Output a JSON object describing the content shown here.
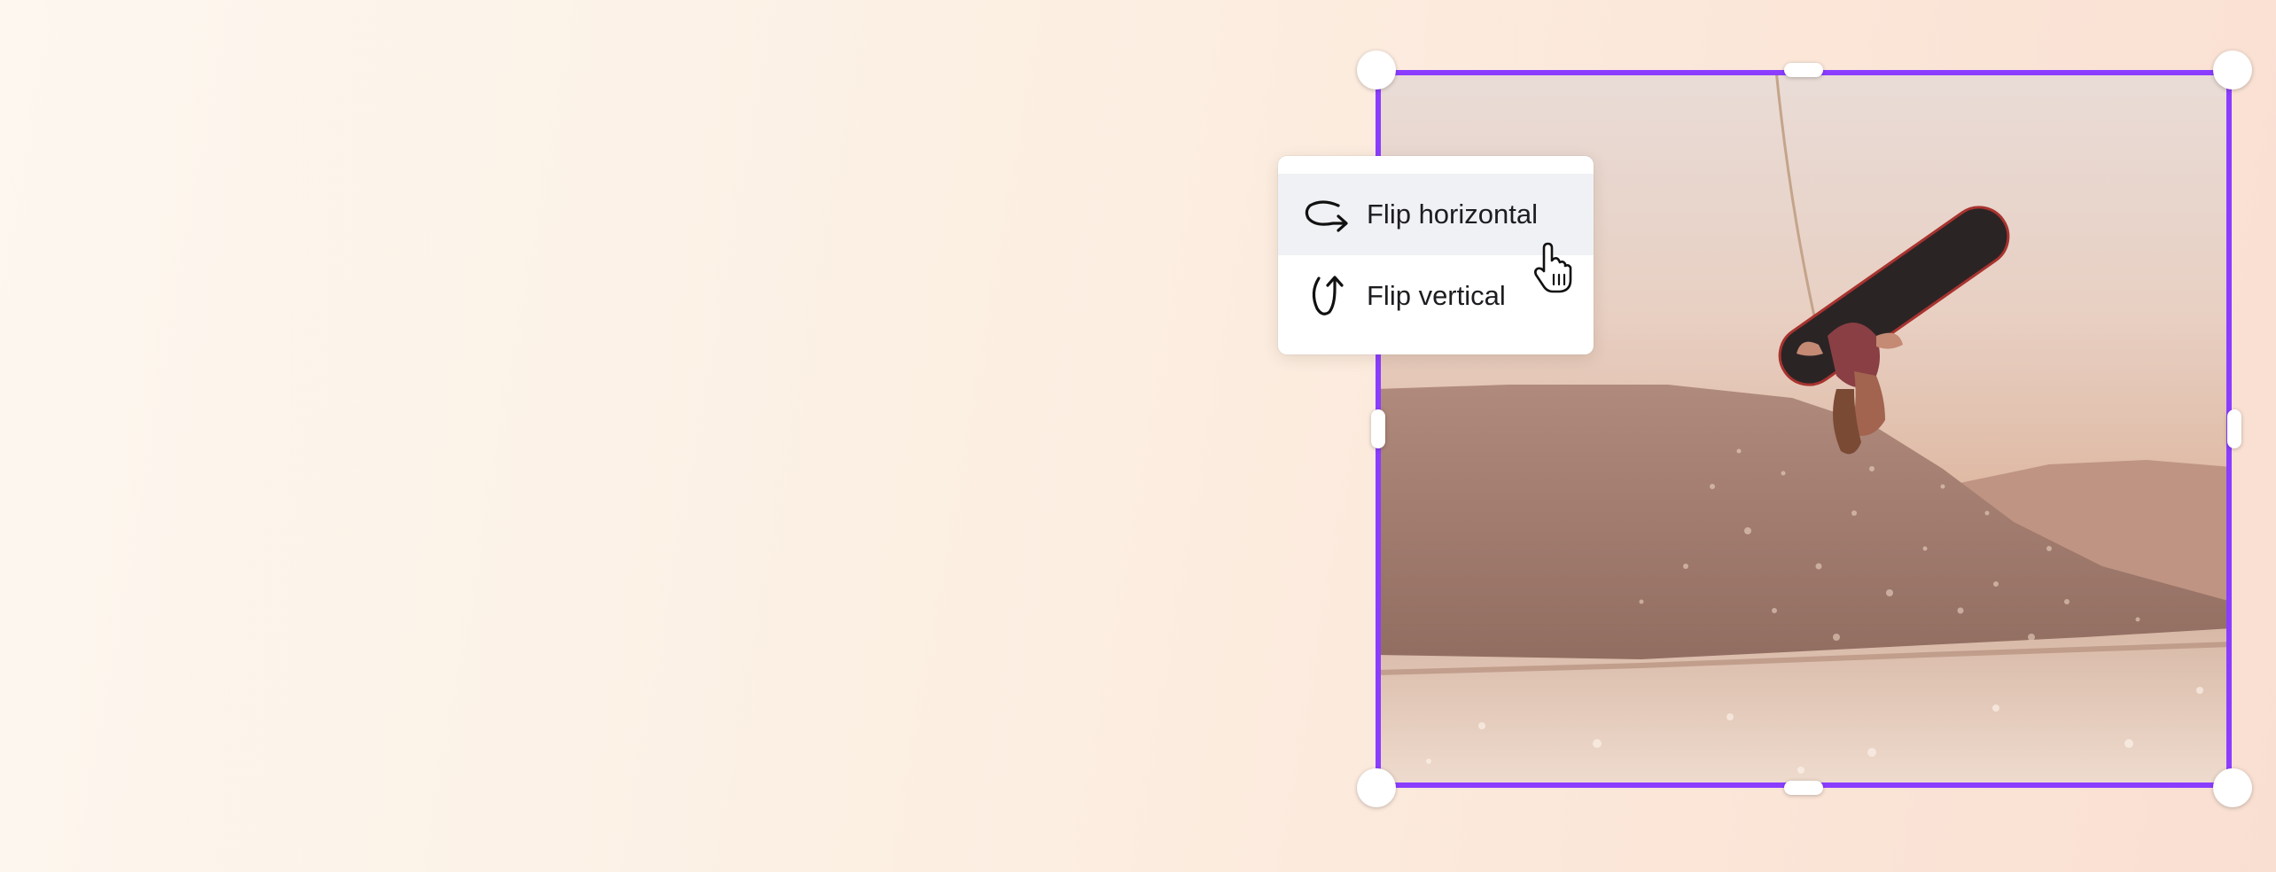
{
  "flip_menu": {
    "items": [
      {
        "label": "Flip horizontal",
        "icon": "flip-horizontal-icon",
        "highlighted": true
      },
      {
        "label": "Flip vertical",
        "icon": "flip-vertical-icon",
        "highlighted": false
      }
    ]
  },
  "colors": {
    "selection": "#8b3dff",
    "menu_highlight": "#f0f1f4"
  }
}
